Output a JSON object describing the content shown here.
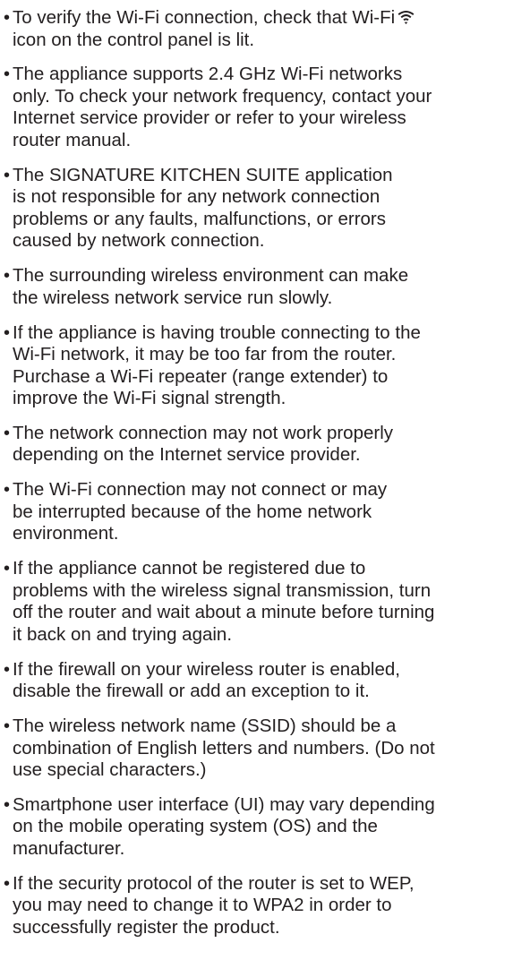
{
  "notes": [
    {
      "lines": [
        "To verify the Wi-Fi connection, check that Wi-Fi",
        "icon on the control panel is lit."
      ],
      "icon": "wifi-icon"
    },
    {
      "lines": [
        "The appliance supports 2.4 GHz Wi-Fi networks",
        "only. To check your network frequency, contact your",
        "Internet service provider or refer to your wireless",
        "router manual."
      ]
    },
    {
      "lines": [
        "The SIGNATURE KITCHEN SUITE application",
        "is not responsible for any network connection",
        "problems or any faults, malfunctions, or errors",
        "caused by network connection."
      ]
    },
    {
      "lines": [
        "The surrounding wireless environment can make",
        "the wireless network service run slowly."
      ]
    },
    {
      "lines": [
        "If the appliance is having trouble connecting to the",
        "Wi-Fi network, it may be too far from the router.",
        "Purchase a Wi-Fi repeater (range extender) to",
        "improve the Wi-Fi signal strength."
      ]
    },
    {
      "lines": [
        "The network connection may not work properly",
        "depending on the Internet service provider."
      ]
    },
    {
      "lines": [
        "The Wi-Fi connection may not connect or may",
        "be interrupted because of the home network",
        "environment."
      ]
    },
    {
      "lines": [
        "If the appliance cannot be registered due to",
        "problems with the wireless signal transmission, turn",
        "off the router and wait about a minute before turning",
        "it back on and trying again."
      ]
    },
    {
      "lines": [
        "If the firewall on your wireless router is enabled,",
        "disable the firewall or add an exception to it."
      ]
    },
    {
      "lines": [
        "The wireless network name (SSID) should be a",
        "combination of English letters and numbers. (Do not",
        "use special characters.)"
      ]
    },
    {
      "lines": [
        "Smartphone user interface (UI) may vary depending",
        "on the mobile operating system (OS) and the",
        "manufacturer."
      ]
    },
    {
      "lines": [
        "If the security protocol of the router is set to WEP,",
        "you may need to change it to WPA2 in order to",
        "successfully register the product."
      ]
    }
  ]
}
